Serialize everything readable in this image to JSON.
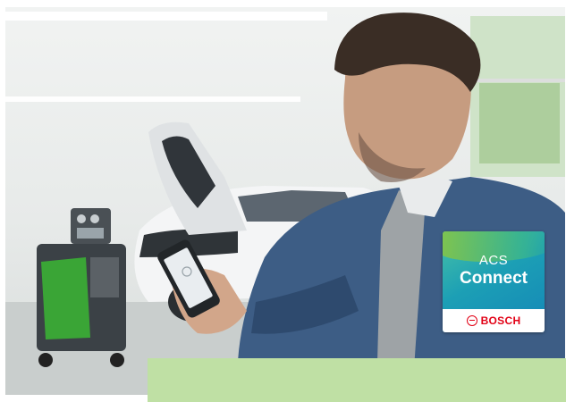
{
  "badge": {
    "line1": "ACS",
    "line2": "Connect",
    "brand": "BOSCH"
  },
  "colors": {
    "banner": "#bfe0a4",
    "brand_red": "#e20015",
    "tile_blue": "#1c9fb5",
    "machine_green": "#3aa536"
  }
}
